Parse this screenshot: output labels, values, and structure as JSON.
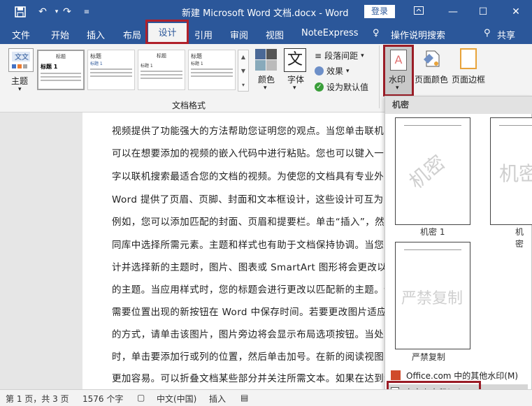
{
  "titlebar": {
    "doc_title": "新建 Microsoft Word 文档.docx  -  Word",
    "login": "登录"
  },
  "menu": {
    "tabs": [
      "文件",
      "开始",
      "插入",
      "布局",
      "设计",
      "引用",
      "审阅",
      "视图",
      "NoteExpress"
    ],
    "tell_me": "操作说明搜索",
    "share": "共享"
  },
  "ribbon": {
    "theme_label": "主题",
    "style_thumbs": [
      {
        "title": "标题",
        "heading": "标题 1"
      },
      {
        "title": "标题",
        "heading": "标题 1"
      },
      {
        "title": "标题",
        "heading": "标题 1"
      },
      {
        "title": "标题",
        "heading": "标题 1"
      }
    ],
    "colors_label": "颜色",
    "fonts_label": "字体",
    "fonts_glyph": "文",
    "paragraph_spacing": "段落间距",
    "effects": "效果",
    "set_default": "设为默认值",
    "group_label": "文档格式",
    "watermark_label": "水印",
    "page_color_label": "页面颜色",
    "page_border_label": "页面边框"
  },
  "document": {
    "lines": [
      "视频提供了功能强大的方法帮助您证明您的观点。当您单击联机视",
      "可以在想要添加的视频的嵌入代码中进行粘贴。您也可以键入一个",
      "字以联机搜索最适合您的文档的视频。为使您的文档具有专业外",
      "Word 提供了页眉、页脚、封面和文本框设计，这些设计可互为",
      "例如，您可以添加匹配的封面、页眉和提要栏。单击“插入”，然后",
      "同库中选择所需元素。主题和样式也有助于文档保持协调。当您单",
      "计并选择新的主题时，图片、图表或 SmartArt 图形将会更改以匹",
      "的主题。当应用样式时，您的标题会进行更改以匹配新的主题。使",
      "需要位置出现的新按钮在 Word 中保存时间。若要更改图片适应",
      "的方式，请单击该图片，图片旁边将会显示布局选项按钮。当处理",
      "时，单击要添加行或列的位置，然后单击加号。在新的阅读视图中",
      "更加容易。可以折叠文档某些部分并关注所需文本。如果在达到结"
    ]
  },
  "watermark_panel": {
    "header": "机密",
    "items": [
      {
        "caption": "机密 1",
        "text": "机密"
      },
      {
        "caption": "机密",
        "text": "机密"
      },
      {
        "caption": "严禁复制",
        "text": "严禁复制"
      }
    ],
    "office_item": "Office.com 中的其他水印(M)",
    "custom_item": "自定义水印(W)..."
  },
  "statusbar": {
    "page": "第 1 页，共 3 页",
    "words": "1576 个字",
    "language": "中文(中国)",
    "insert": "插入"
  },
  "colors": {
    "word_blue": "#2b579a",
    "highlight_red": "#9a1c26"
  }
}
